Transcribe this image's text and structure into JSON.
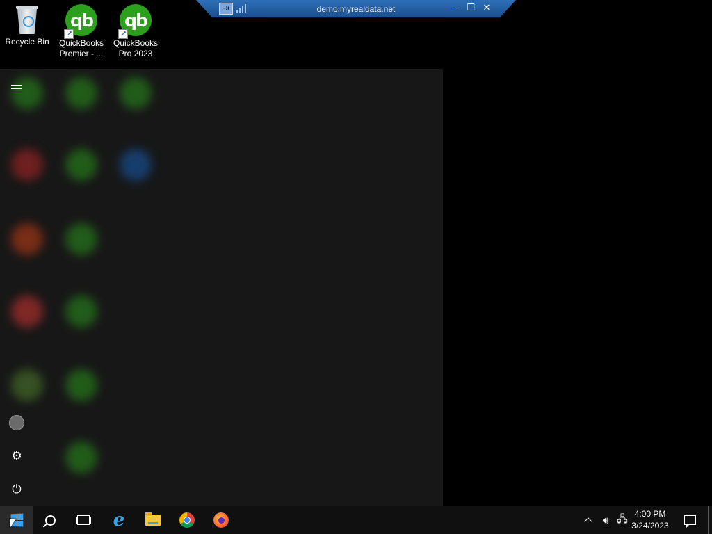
{
  "desktop": {
    "icons": [
      {
        "label": "Recycle Bin",
        "icon": "recycle-bin-icon"
      },
      {
        "label": "QuickBooks Premier - ...",
        "line1": "QuickBooks",
        "line2": "Premier - ...",
        "icon": "quickbooks-icon"
      },
      {
        "label": "QuickBooks Pro 2023",
        "line1": "QuickBooks",
        "line2": "Pro 2023",
        "icon": "quickbooks-icon"
      }
    ]
  },
  "remote_bar": {
    "title": "demo.myrealdata.net",
    "pin_glyph": "⇥",
    "minimize_glyph": "‒",
    "restore_glyph": "❐",
    "close_glyph": "✕"
  },
  "start_menu": {
    "rail": {
      "menu_icon": "hamburger-icon",
      "user_icon": "user-avatar",
      "settings_glyph": "⚙",
      "power_glyph": "⏻"
    },
    "colors": {
      "background": "#171717",
      "tile_green": "#2ca01c",
      "tile_red": "#c62828",
      "tile_blue": "#1565c0"
    }
  },
  "taskbar": {
    "pinned": [
      "start",
      "search",
      "task-view",
      "internet-explorer",
      "file-explorer",
      "chrome",
      "firefox"
    ],
    "tray": {
      "chevron_glyph": "^",
      "volume_glyph": "🔊︎",
      "network_glyph": "🖧",
      "notification_icon": "notification-icon"
    },
    "clock": {
      "time": "4:00 PM",
      "date": "3/24/2023"
    },
    "colors": {
      "taskbar": "#101010",
      "start_active": "#2a2a2a",
      "windows_blue": "#3aa3f0"
    }
  }
}
